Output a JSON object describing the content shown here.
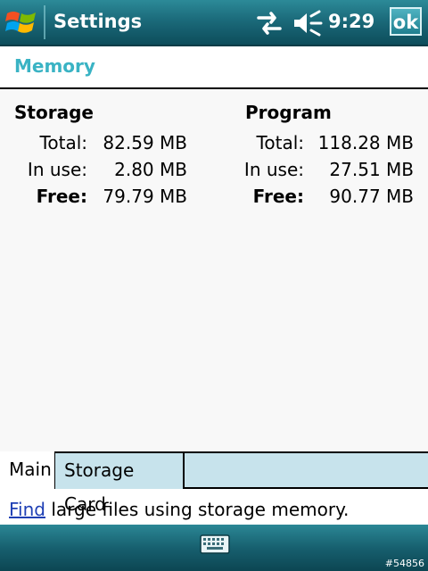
{
  "titlebar": {
    "title": "Settings",
    "clock": "9:29",
    "ok_label": "ok"
  },
  "heading": "Memory",
  "storage": {
    "title": "Storage",
    "total_label": "Total:",
    "total_value": "82.59 MB",
    "inuse_label": "In use:",
    "inuse_value": "2.80 MB",
    "free_label": "Free:",
    "free_value": "79.79 MB"
  },
  "program": {
    "title": "Program",
    "total_label": "Total:",
    "total_value": "118.28 MB",
    "inuse_label": "In use:",
    "inuse_value": "27.51 MB",
    "free_label": "Free:",
    "free_value": "90.77 MB"
  },
  "tabs": [
    {
      "label": "Main",
      "active": true
    },
    {
      "label": "Storage Card",
      "active": false
    }
  ],
  "find": {
    "link_text": "Find",
    "rest_text": " large files using storage memory."
  },
  "stamp": "#54856",
  "colors": {
    "accent": "#3ab3c4",
    "titlebar": "#1b6a7a",
    "tab_bg": "#c7e3ec",
    "link": "#1e3fb4"
  },
  "icons": [
    "windows-start-icon",
    "connectivity-arrows-icon",
    "volume-muted-icon",
    "keyboard-icon"
  ]
}
